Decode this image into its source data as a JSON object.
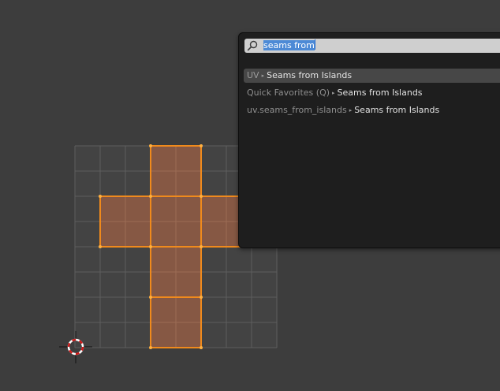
{
  "search": {
    "query_selected": "seams from",
    "query_rest": ""
  },
  "results": [
    {
      "prefix": "UV",
      "name": "Seams from Islands",
      "active": true
    },
    {
      "prefix": "Quick Favorites (Q)",
      "name": "Seams from Islands",
      "active": false
    },
    {
      "prefix": "uv.seams_from_islands",
      "name": "Seams from Islands",
      "active": false
    }
  ],
  "icons": {
    "search": "search-icon",
    "arrow": "breadcrumb-arrow-icon",
    "cursor": "3d-cursor-icon"
  },
  "colors": {
    "background": "#3d3d3d",
    "grid_line": "#5e5e5e",
    "selected_face": "#8a5a44",
    "selected_edge": "#f08a1c",
    "popup_bg": "#1e1e1e",
    "search_bg": "#cfcfcf",
    "text_highlight": "#4d8ad6"
  }
}
